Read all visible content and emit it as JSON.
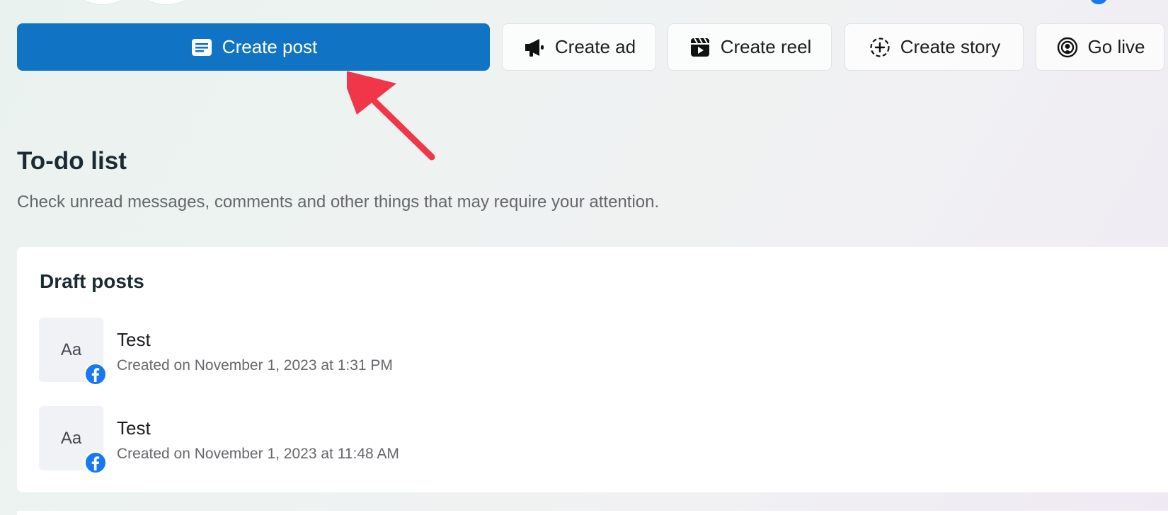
{
  "actions": {
    "create_post": "Create post",
    "create_ad": "Create ad",
    "create_reel": "Create reel",
    "create_story": "Create story",
    "go_live": "Go live",
    "primary_color": "#1173c4"
  },
  "todo": {
    "title": "To-do list",
    "subtitle": "Check unread messages, comments and other things that may require your attention."
  },
  "drafts": {
    "title": "Draft posts",
    "items": [
      {
        "thumb": "Aa",
        "title": "Test",
        "meta": "Created on November 1, 2023 at 1:31 PM"
      },
      {
        "thumb": "Aa",
        "title": "Test",
        "meta": "Created on November 1, 2023 at 11:48 AM"
      }
    ]
  },
  "icons": {
    "create_post": "post-icon",
    "create_ad": "megaphone-icon",
    "create_reel": "clapperboard-icon",
    "create_story": "story-add-icon",
    "go_live": "live-icon",
    "badge": "facebook-icon"
  },
  "annotation_color": "#f2364a"
}
